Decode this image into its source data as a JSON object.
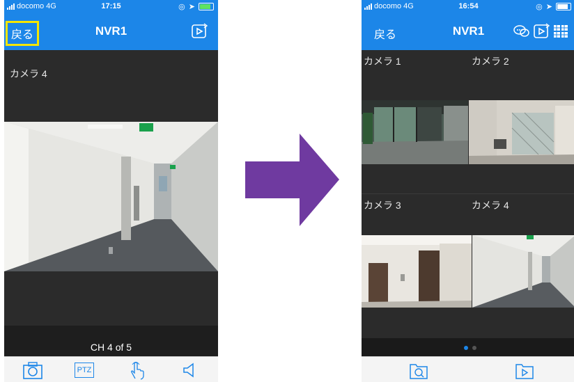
{
  "left_phone": {
    "status": {
      "carrier": "docomo",
      "network": "4G",
      "time": "17:15"
    },
    "nav": {
      "back_label": "戻る",
      "title": "NVR1"
    },
    "camera_label": "カメラ 4",
    "channel_text": "CH 4 of 5",
    "toolbar": {
      "snapshot_icon": "camera-icon",
      "ptz_label": "PTZ",
      "touch_icon": "hand-touch-icon",
      "audio_icon": "speaker-icon"
    }
  },
  "right_phone": {
    "status": {
      "carrier": "docomo",
      "network": "4G",
      "time": "16:54"
    },
    "nav": {
      "back_label": "戻る",
      "title": "NVR1"
    },
    "cameras": [
      {
        "label": "カメラ 1"
      },
      {
        "label": "カメラ 2"
      },
      {
        "label": "カメラ 3"
      },
      {
        "label": "カメラ 4"
      }
    ],
    "pager": {
      "pages": 2,
      "current": 1
    },
    "toolbar": {
      "search_icon": "folder-search-icon",
      "playback_icon": "folder-play-icon"
    }
  },
  "colors": {
    "accent": "#1c86e8",
    "highlight_outline": "#f5e600",
    "arrow": "#6f3aa0",
    "dark_bg": "#2b2b2b"
  }
}
